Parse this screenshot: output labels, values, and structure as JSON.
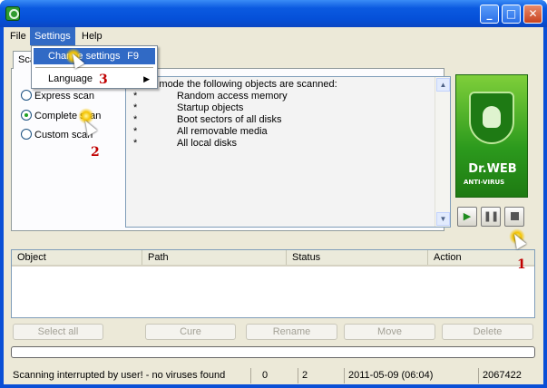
{
  "menubar": {
    "items": [
      {
        "label": "File"
      },
      {
        "label": "Settings"
      },
      {
        "label": "Help"
      }
    ]
  },
  "settings_menu": {
    "items": [
      {
        "label": "Change settings",
        "shortcut": "F9"
      },
      {
        "label": "Language"
      }
    ]
  },
  "tab": {
    "label": "Scan"
  },
  "scan_modes": [
    {
      "label": "Express scan",
      "checked": false
    },
    {
      "label": "Complete scan",
      "checked": true
    },
    {
      "label": "Custom scan",
      "checked": false
    }
  ],
  "info": {
    "intro": "In this mode the following objects are scanned:",
    "bullet": "*",
    "items": [
      "Random access memory",
      "Startup objects",
      "Boot sectors of all disks",
      "All removable media",
      "All local disks"
    ]
  },
  "logo": {
    "name": "Dr.WEB",
    "sub": "ANTI-VIRUS",
    "color": "#2c9a1d"
  },
  "controls": {
    "play_icon": "play-icon",
    "pause_icon": "pause-icon",
    "stop_icon": "stop-icon"
  },
  "results": {
    "columns": [
      "Object",
      "Path",
      "Status",
      "Action"
    ]
  },
  "actions": {
    "select_all": "Select all",
    "cure": "Cure",
    "rename": "Rename",
    "move": "Move",
    "delete": "Delete"
  },
  "status": {
    "message": "Scanning interrupted by user! - no viruses found",
    "count_a": "0",
    "count_b": "2",
    "datetime": "2011-05-09 (06:04)",
    "records": "2067422"
  },
  "annotations": {
    "step1": "1",
    "step2": "2",
    "step3": "3"
  }
}
